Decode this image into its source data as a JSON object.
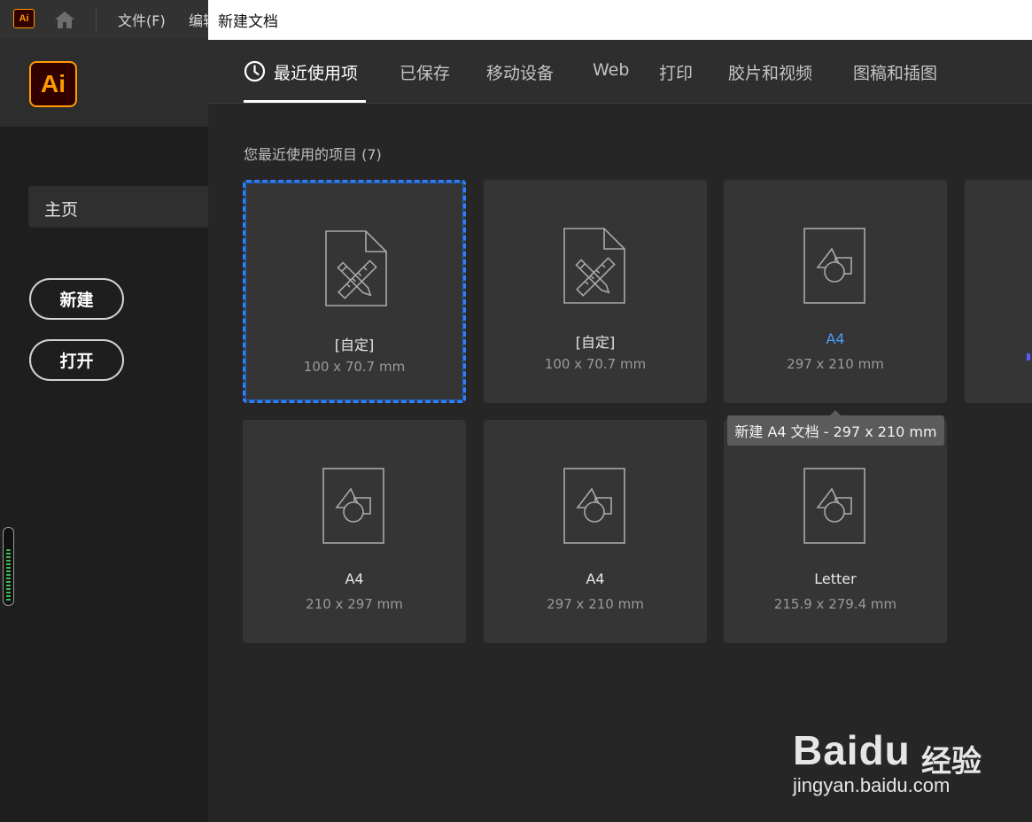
{
  "menubar": {
    "app_badge": "Ai",
    "menus": [
      "文件(F)",
      "编辑"
    ]
  },
  "sidebar": {
    "logo": "Ai",
    "home_label": "主页",
    "new_button": "新建",
    "open_button": "打开"
  },
  "dialog": {
    "title": "新建文档",
    "tabs": [
      {
        "label": "最近使用项",
        "active": true
      },
      {
        "label": "已保存",
        "active": false
      },
      {
        "label": "移动设备",
        "active": false
      },
      {
        "label": "Web",
        "active": false
      },
      {
        "label": "打印",
        "active": false
      },
      {
        "label": "胶片和视频",
        "active": false
      },
      {
        "label": "图稿和插图",
        "active": false
      }
    ],
    "section_title": "您最近使用的项目 (7)",
    "presets": [
      {
        "name": "[自定]",
        "size": "100 x 70.7 mm",
        "icon": "custom-document-icon",
        "selected": true
      },
      {
        "name": "[自定]",
        "size": "100 x 70.7 mm",
        "icon": "custom-document-icon",
        "selected": false
      },
      {
        "name": "A4",
        "size": "297 x 210 mm",
        "icon": "shapes-document-icon",
        "selected": false
      },
      {
        "name": "A4",
        "size": "210 x 297 mm",
        "icon": "shapes-document-icon",
        "selected": false
      },
      {
        "name": "A4",
        "size": "297 x 210 mm",
        "icon": "shapes-document-icon",
        "selected": false
      },
      {
        "name": "Letter",
        "size": "215.9 x 279.4 mm",
        "icon": "shapes-document-icon",
        "selected": false
      }
    ],
    "tooltip": "新建 A4 文档 - 297 x 210 mm"
  },
  "watermark": {
    "brand": "Baidu",
    "brand_cn": "经验",
    "url": "jingyan.baidu.com"
  },
  "colors": {
    "accent_blue": "#2d7ff9",
    "link_blue": "#4d9bff",
    "ai_orange": "#ff9a00",
    "ai_dark": "#330000"
  }
}
